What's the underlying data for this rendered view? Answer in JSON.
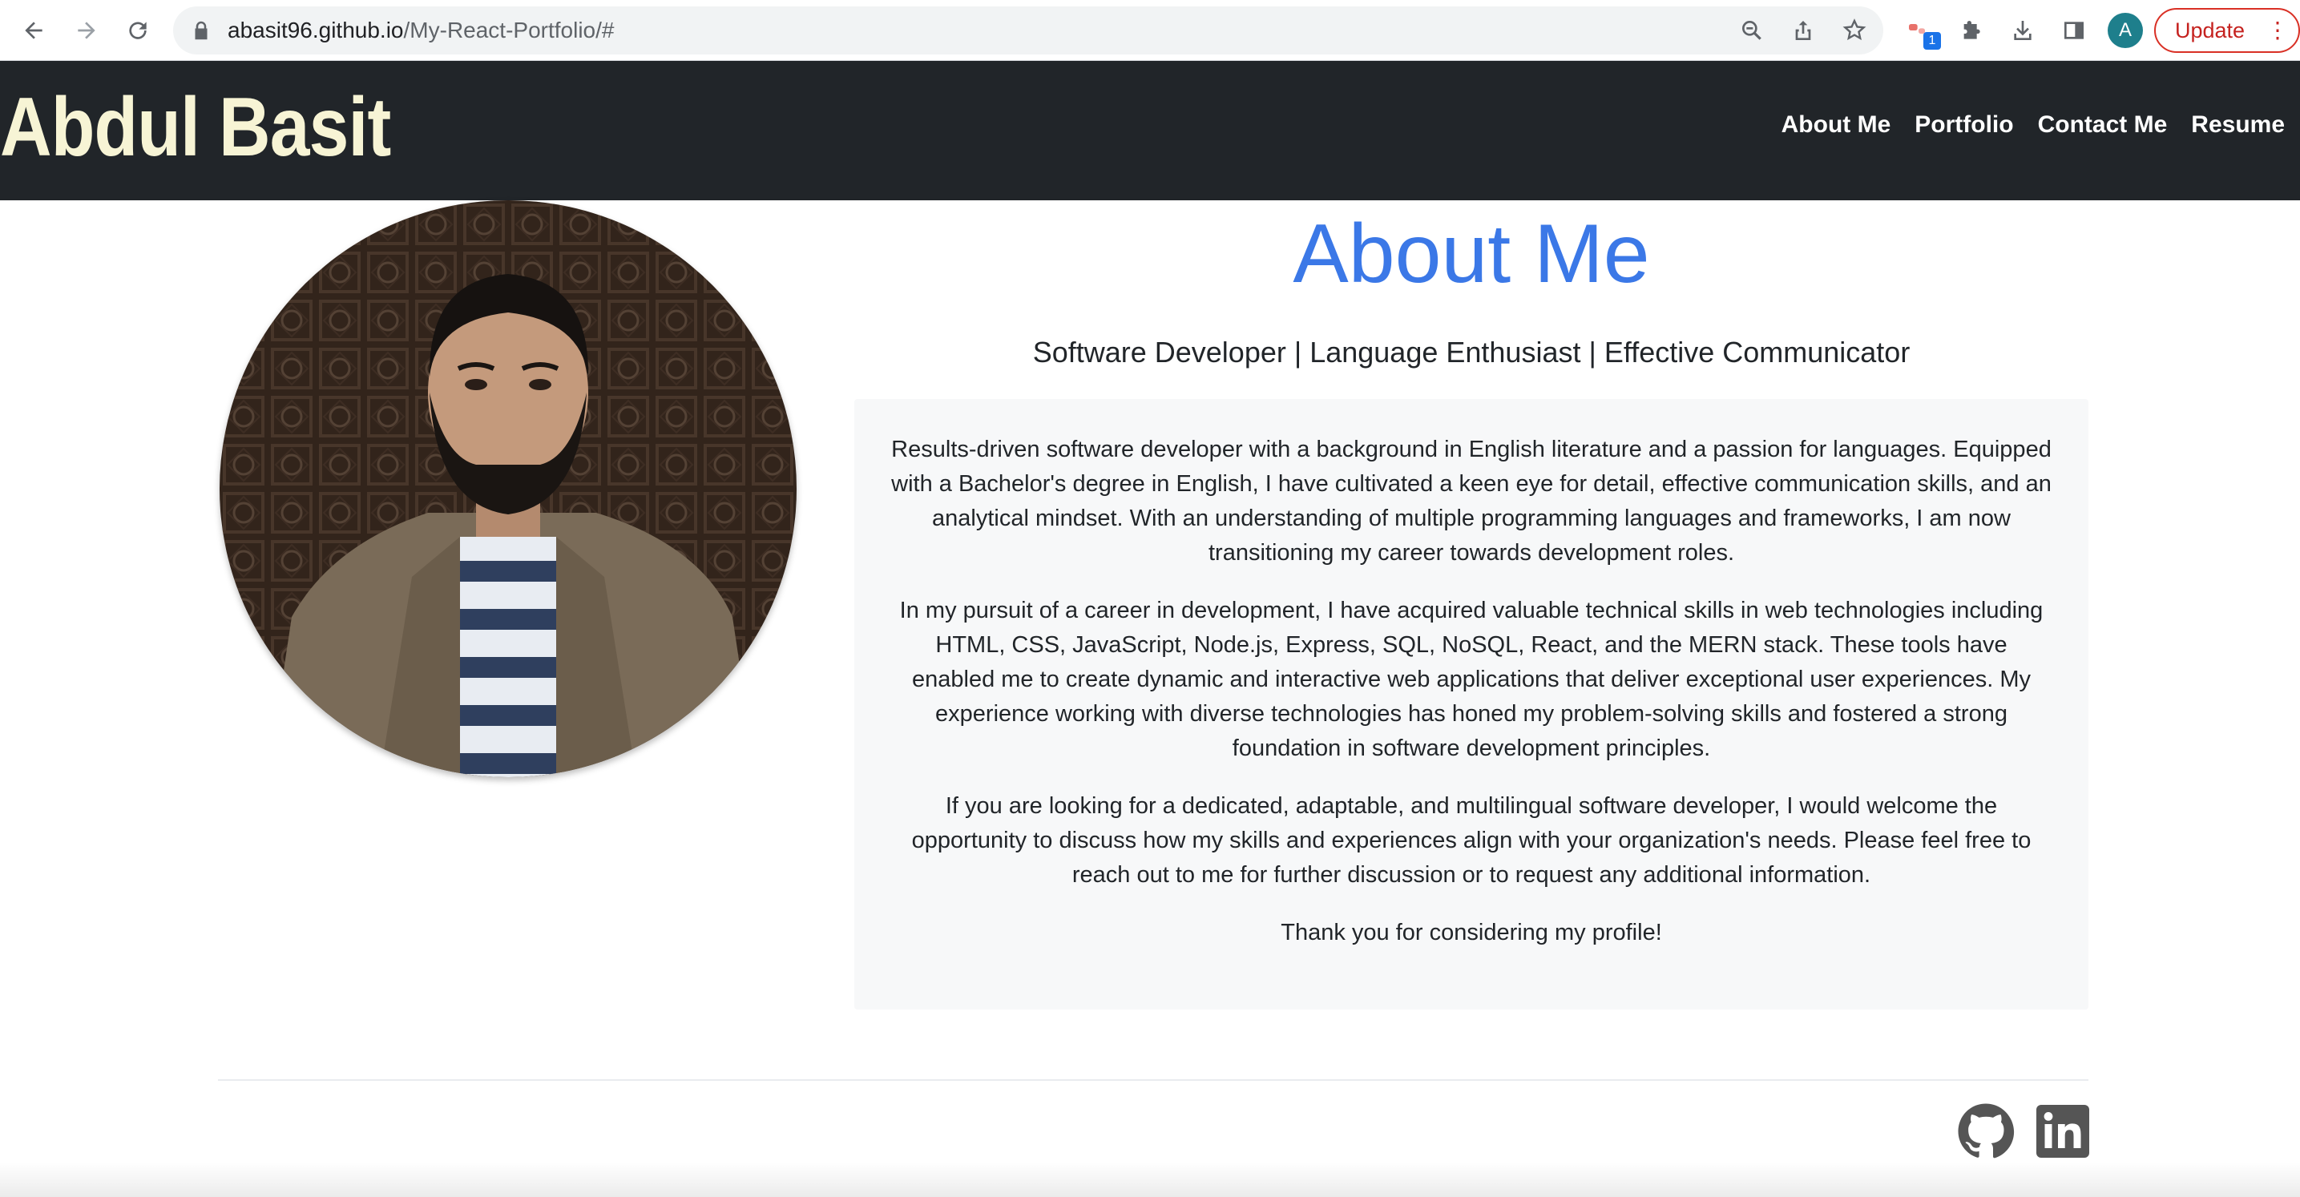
{
  "browser": {
    "url_host": "abasit96.github.io",
    "url_path": "/My-React-Portfolio/#",
    "profile_initial": "A",
    "update_label": "Update",
    "extension_badge": "1",
    "icons": [
      "back-icon",
      "forward-icon",
      "reload-icon",
      "lock-icon",
      "zoom-icon",
      "share-icon",
      "bookmark-star-icon",
      "extension-icon",
      "puzzle-icon",
      "download-icon",
      "side-panel-icon",
      "more-vert-icon"
    ]
  },
  "header": {
    "brand": "Abdul Basit",
    "nav": [
      "About Me",
      "Portfolio",
      "Contact Me",
      "Resume"
    ]
  },
  "about": {
    "title": "About Me",
    "subtitle": "Software Developer | Language Enthusiast | Effective Communicator",
    "paragraphs": [
      "Results-driven software developer with a background in English literature and a passion for languages. Equipped with a Bachelor's degree in English, I have cultivated a keen eye for detail, effective communication skills, and an analytical mindset. With an understanding of multiple programming languages and frameworks, I am now transitioning my career towards development roles.",
      "In my pursuit of a career in development, I have acquired valuable technical skills in web technologies including HTML, CSS, JavaScript, Node.js, Express, SQL, NoSQL, React, and the MERN stack. These tools have enabled me to create dynamic and interactive web applications that deliver exceptional user experiences. My experience working with diverse technologies has honed my problem-solving skills and fostered a strong foundation in software development principles.",
      "If you are looking for a dedicated, adaptable, and multilingual software developer, I would welcome the opportunity to discuss how my skills and experiences align with your organization's needs. Please feel free to reach out to me for further discussion or to request any additional information.",
      "Thank you for considering my profile!"
    ]
  },
  "footer": {
    "links": [
      "github-icon",
      "linkedin-icon"
    ]
  },
  "colors": {
    "header_bg": "#212529",
    "brand": "#f7f4d5",
    "title_blue": "#3b78e7",
    "card_bg": "#f7f8f9"
  }
}
